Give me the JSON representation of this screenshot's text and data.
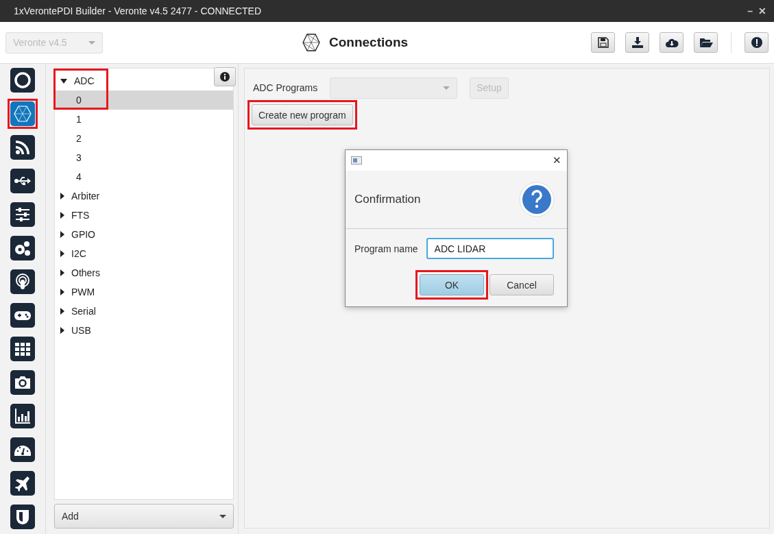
{
  "window": {
    "title": "1xVerontePDI Builder - Veronte v4.5 2477 - CONNECTED",
    "controls": [
      "–",
      "✕"
    ]
  },
  "header": {
    "version_select": {
      "value": "Veronte v4.5",
      "disabled": true
    },
    "title": "Connections"
  },
  "rail": [
    {
      "selected": false,
      "highlighted": false
    },
    {
      "selected": true,
      "highlighted": true
    },
    {
      "selected": false,
      "highlighted": false
    },
    {
      "selected": false,
      "highlighted": false
    },
    {
      "selected": false,
      "highlighted": false
    },
    {
      "selected": false,
      "highlighted": false
    },
    {
      "selected": false,
      "highlighted": false
    },
    {
      "selected": false,
      "highlighted": false
    },
    {
      "selected": false,
      "highlighted": false
    },
    {
      "selected": false,
      "highlighted": false
    },
    {
      "selected": false,
      "highlighted": false
    },
    {
      "selected": false,
      "highlighted": false
    },
    {
      "selected": false,
      "highlighted": false
    },
    {
      "selected": false,
      "highlighted": false
    }
  ],
  "tree": {
    "highlighted": true,
    "items": [
      {
        "label": "ADC",
        "expanded": true,
        "children": [
          {
            "label": "0",
            "selected": true
          },
          {
            "label": "1",
            "selected": false
          },
          {
            "label": "2",
            "selected": false
          },
          {
            "label": "3",
            "selected": false
          },
          {
            "label": "4",
            "selected": false
          }
        ]
      },
      {
        "label": "Arbiter",
        "expanded": false
      },
      {
        "label": "FTS",
        "expanded": false
      },
      {
        "label": "GPIO",
        "expanded": false
      },
      {
        "label": "I2C",
        "expanded": false
      },
      {
        "label": "Others",
        "expanded": false
      },
      {
        "label": "PWM",
        "expanded": false
      },
      {
        "label": "Serial",
        "expanded": false
      },
      {
        "label": "USB",
        "expanded": false
      }
    ],
    "add_button": "Add"
  },
  "content": {
    "programs_label": "ADC Programs",
    "setup_button": {
      "label": "Setup",
      "disabled": true
    },
    "create_button": {
      "label": "Create new program",
      "highlighted": true
    }
  },
  "dialog": {
    "heading": "Confirmation",
    "field_label": "Program name",
    "field_value": "ADC LIDAR",
    "close": "✕",
    "buttons": [
      {
        "label": "OK",
        "kind": "default",
        "highlighted": true
      },
      {
        "label": "Cancel",
        "kind": "normal",
        "highlighted": false
      }
    ]
  }
}
